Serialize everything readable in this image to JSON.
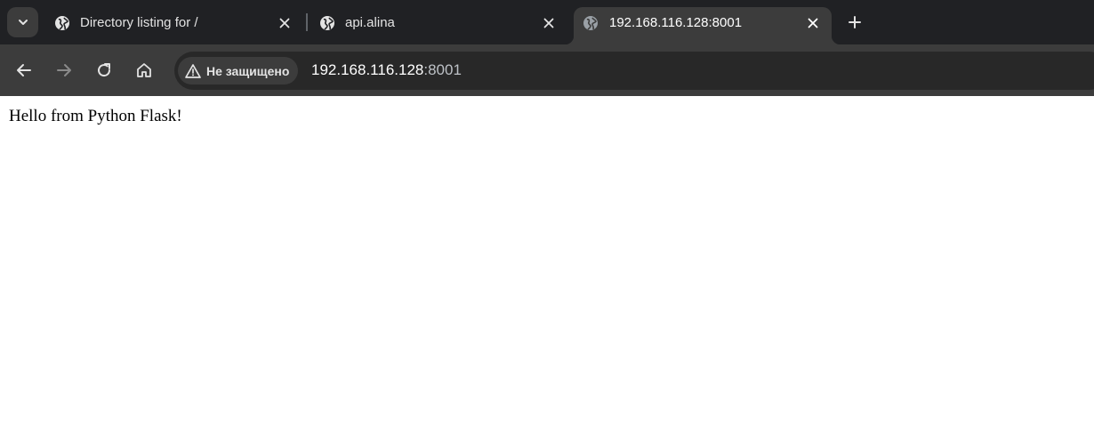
{
  "tabs": [
    {
      "title": "Directory listing for /",
      "icon": "globe-icon",
      "active": false
    },
    {
      "title": "api.alina",
      "icon": "globe-icon",
      "active": false
    },
    {
      "title": "192.168.116.128:8001",
      "icon": "globe-icon",
      "active": true
    }
  ],
  "toolbar": {
    "security_label": "Не защищено",
    "url_host": "192.168.116.128",
    "url_port": ":8001"
  },
  "page": {
    "body_text": "Hello from Python Flask!"
  },
  "colors": {
    "tabstrip_bg": "#202124",
    "toolbar_bg": "#3c3c3c",
    "omnibox_bg": "#282828",
    "tab_text": "#e3e3e3",
    "page_bg": "#ffffff"
  }
}
